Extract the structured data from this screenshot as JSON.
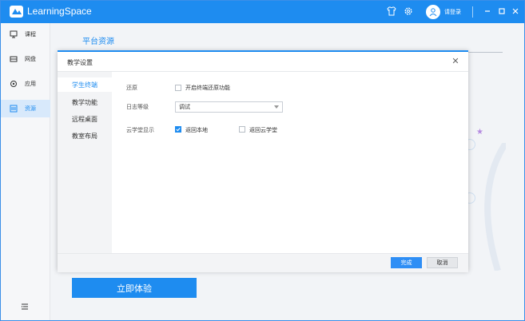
{
  "app": {
    "title": "LearningSpace",
    "login_text": "请登录"
  },
  "titlebar": {
    "icons": [
      "shirt-icon",
      "gear-icon",
      "user-icon",
      "minimize-icon",
      "maximize-icon",
      "close-icon"
    ]
  },
  "sidebar": {
    "items": [
      {
        "label": "课程",
        "icon": "course-icon"
      },
      {
        "label": "网盘",
        "icon": "drive-icon"
      },
      {
        "label": "应用",
        "icon": "app-icon"
      },
      {
        "label": "资源",
        "icon": "resource-icon",
        "active": true
      }
    ]
  },
  "content": {
    "platform_title": "平台资源",
    "try_button": "立即体验"
  },
  "dialog": {
    "title": "教学设置",
    "nav": [
      "学生终端",
      "教学功能",
      "远程桌面",
      "教室布局"
    ],
    "active_nav": "学生终端",
    "restore": {
      "label": "还原",
      "checkbox_label": "开启终端还原功能",
      "checked": false
    },
    "log_level": {
      "label": "日志等级",
      "value": "调试"
    },
    "cloud_display": {
      "label": "云学堂显示",
      "option1": {
        "label": "返回本地",
        "checked": true
      },
      "option2": {
        "label": "返回云学堂",
        "checked": false
      }
    },
    "ok_button": "完成",
    "cancel_button": "取消"
  },
  "colors": {
    "accent": "#1e8cf0",
    "sidebar_active_bg": "#d8e9fb"
  }
}
